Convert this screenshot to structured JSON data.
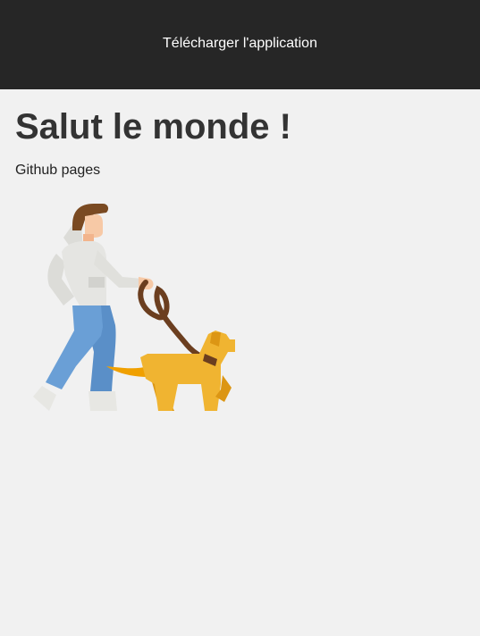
{
  "header": {
    "download_link": "Télécharger l'application"
  },
  "main": {
    "title": "Salut le monde !",
    "subtitle": "Github pages"
  },
  "illustration": {
    "icon": "person-walking-dog-icon"
  },
  "colors": {
    "header_background": "#262626",
    "page_background": "#f1f1f1",
    "text": "#333333",
    "hair": "#7a4a22",
    "skin": "#f7c9a6",
    "hoodie": "#e5e5e2",
    "jeans": "#6a9fd6",
    "dog": "#f0b431",
    "dog_shadow": "#dc9614",
    "leash": "#6b3e1f"
  }
}
